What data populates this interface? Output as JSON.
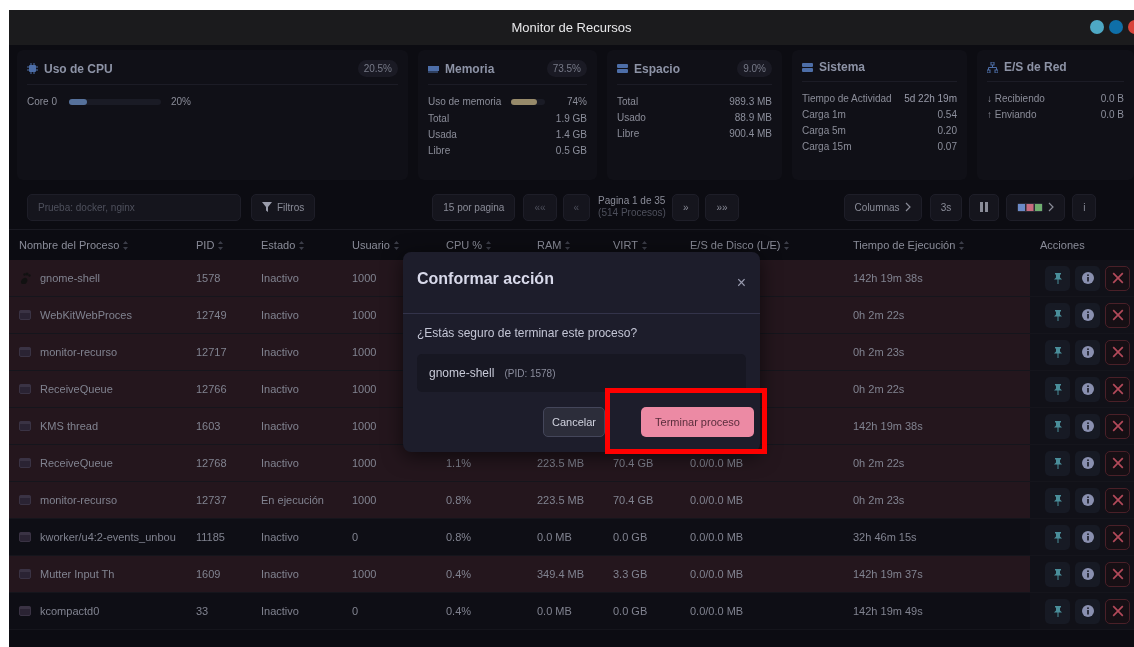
{
  "window": {
    "title": "Monitor de Recursos",
    "controls": [
      {
        "color": "#4ea8c4"
      },
      {
        "color": "#0f6fa8"
      },
      {
        "color": "#d9443a"
      }
    ]
  },
  "cards": [
    {
      "kind": "cpu",
      "title": "Uso de CPU",
      "badge": "20.5%",
      "bars": [
        {
          "label": "Core 0",
          "level": 0.2,
          "reading": "20%"
        }
      ]
    },
    {
      "kind": "memory",
      "title": "Memoria",
      "badge": "73.5%",
      "bars": [
        {
          "label": "Uso de memoria",
          "level": 0.74,
          "reading": "74%"
        }
      ],
      "rows": [
        {
          "label": "Total",
          "value": "1.9 GB"
        },
        {
          "label": "Usada",
          "value": "1.4 GB"
        },
        {
          "label": "Libre",
          "value": "0.5 GB"
        }
      ]
    },
    {
      "kind": "disk",
      "title": "Espacio",
      "badge": "9.0%",
      "rows": [
        {
          "label": "Total",
          "value": "989.3 MB"
        },
        {
          "label": "Usado",
          "value": "88.9 MB"
        },
        {
          "label": "Libre",
          "value": "900.4 MB"
        }
      ]
    },
    {
      "kind": "system",
      "title": "Sistema",
      "rows": [
        {
          "label": "Tiempo de Actividad",
          "value": "5d 22h 19m"
        },
        {
          "label": "Carga 1m",
          "value": "0.54"
        },
        {
          "label": "Carga 5m",
          "value": "0.20"
        },
        {
          "label": "Carga 15m",
          "value": "0.07"
        }
      ]
    },
    {
      "kind": "network",
      "title": "E/S de Red",
      "rows": [
        {
          "label": "↓ Recibiendo",
          "value": "0.0 B"
        },
        {
          "label": "↑ Enviando",
          "value": "0.0 B"
        }
      ]
    }
  ],
  "toolbar": {
    "search": {
      "placeholder": "Prueba: docker, nginx"
    },
    "filters": "Filtros",
    "per_page": "15 por pagina",
    "first": "««",
    "prev": "«",
    "page": "Pagina 1 de 35",
    "count": "(514 Procesos)",
    "next": "»",
    "last": "»»",
    "columns": "Columnas",
    "interval": "3s",
    "info": "i"
  },
  "table": {
    "columns": [
      {
        "label": "Nombre del Proceso",
        "sortable": true
      },
      {
        "label": "PID",
        "sortable": true
      },
      {
        "label": "Estado",
        "sortable": true
      },
      {
        "label": "Usuario",
        "sortable": true
      },
      {
        "label": "CPU %",
        "sortable": true
      },
      {
        "label": "RAM",
        "sortable": true
      },
      {
        "label": "VIRT",
        "sortable": true
      },
      {
        "label": "E/S de Disco (L/E)",
        "sortable": true
      },
      {
        "label": "Tiempo de Ejecución",
        "sortable": true
      },
      {
        "label": "Acciones",
        "sortable": false
      }
    ],
    "rows": [
      {
        "kind": "logo",
        "tinted": true,
        "name": "gnome-shell",
        "pid": "1578",
        "state": "Inactivo",
        "user": "1000",
        "time": "142h 19m 38s"
      },
      {
        "kind": "window",
        "tinted": true,
        "name": "WebKitWebProces",
        "pid": "12749",
        "state": "Inactivo",
        "user": "1000",
        "time": "0h 2m 22s"
      },
      {
        "kind": "window",
        "tinted": true,
        "name": "monitor-recurso",
        "pid": "12717",
        "state": "Inactivo",
        "user": "1000",
        "time": "0h 2m 23s"
      },
      {
        "kind": "window",
        "tinted": true,
        "name": "ReceiveQueue",
        "pid": "12766",
        "state": "Inactivo",
        "user": "1000",
        "time": "0h 2m 22s"
      },
      {
        "kind": "window",
        "tinted": true,
        "name": "KMS thread",
        "pid": "1603",
        "state": "Inactivo",
        "user": "1000",
        "time": "142h 19m 38s"
      },
      {
        "kind": "window",
        "tinted": true,
        "name": "ReceiveQueue",
        "pid": "12768",
        "state": "Inactivo",
        "user": "1000",
        "cpu": "1.1%",
        "ram": "223.5 MB",
        "virt": "70.4 GB",
        "io": "0.0/0.0 MB",
        "time": "0h 2m 22s"
      },
      {
        "kind": "window",
        "tinted": true,
        "name": "monitor-recurso",
        "pid": "12737",
        "state": "En ejecución",
        "user": "1000",
        "cpu": "0.8%",
        "ram": "223.5 MB",
        "virt": "70.4 GB",
        "io": "0.0/0.0 MB",
        "time": "0h 2m 23s"
      },
      {
        "kind": "window",
        "tinted": false,
        "name": "kworker/u4:2-events_unbou",
        "pid": "11185",
        "state": "Inactivo",
        "user": "0",
        "cpu": "0.8%",
        "ram": "0.0 MB",
        "virt": "0.0 GB",
        "io": "0.0/0.0 MB",
        "time": "32h 46m 15s"
      },
      {
        "kind": "window",
        "tinted": true,
        "name": "Mutter Input Th",
        "pid": "1609",
        "state": "Inactivo",
        "user": "1000",
        "cpu": "0.4%",
        "ram": "349.4 MB",
        "virt": "3.3 GB",
        "io": "0.0/0.0 MB",
        "time": "142h 19m 37s"
      },
      {
        "kind": "window",
        "tinted": false,
        "name": "kcompactd0",
        "pid": "33",
        "state": "Inactivo",
        "user": "0",
        "cpu": "0.4%",
        "ram": "0.0 MB",
        "virt": "0.0 GB",
        "io": "0.0/0.0 MB",
        "time": "142h 19m 49s"
      }
    ]
  },
  "dialog": {
    "title": "Conformar acción",
    "close": "×",
    "message": "¿Estás seguro de terminar este proceso?",
    "process": "gnome-shell",
    "pid": "(PID: 1578)",
    "cancel": "Cancelar",
    "confirm": "Terminar proceso",
    "confirm_highlighted": true
  }
}
